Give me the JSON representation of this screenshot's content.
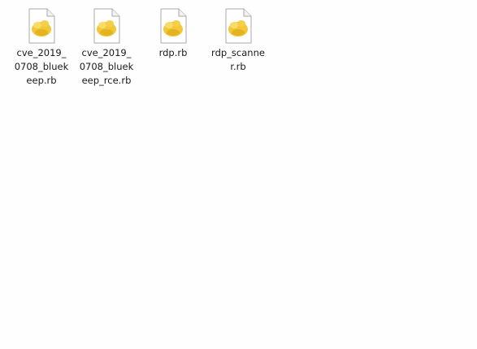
{
  "window": {
    "title": ""
  },
  "files": [
    {
      "name": "cve_2019_0708_bluekeep.rb",
      "icon": "ruby-file-icon"
    },
    {
      "name": "cve_2019_0708_bluekeep_rce.rb",
      "icon": "ruby-file-icon"
    },
    {
      "name": "rdp.rb",
      "icon": "ruby-file-icon"
    },
    {
      "name": "rdp_scanner.rb",
      "icon": "ruby-file-icon"
    }
  ],
  "colors": {
    "background": "#fefefe",
    "icon_body": "#f3c838",
    "page_fill": "#ffffff",
    "page_border": "#a9a9a9",
    "text": "#1a1a1a"
  }
}
